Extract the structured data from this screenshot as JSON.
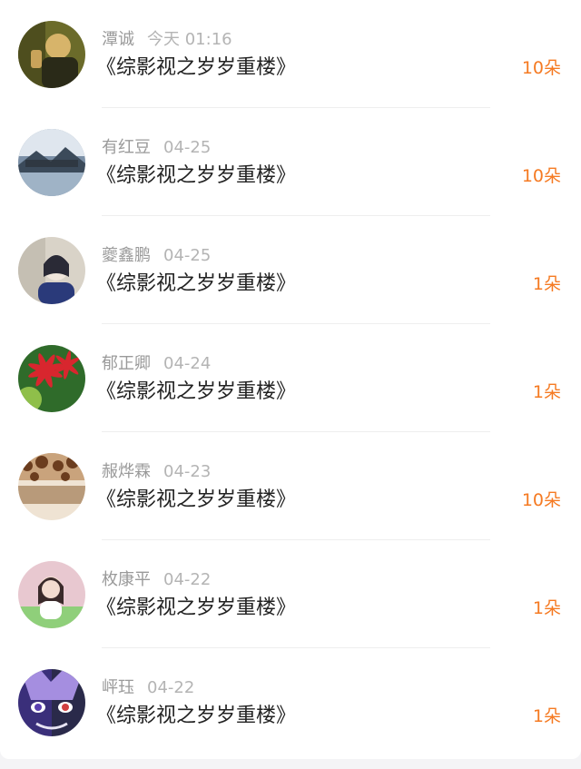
{
  "records": [
    {
      "name": "潭诚",
      "time": "今天 01:16",
      "title": "《综影视之岁岁重楼》",
      "amount": "10朵",
      "avatar_icon": "avatar-smoking-man-icon",
      "colors": [
        "#6b6b2a",
        "#d7b46a",
        "#2a2a18"
      ]
    },
    {
      "name": "有红豆",
      "time": "04-25",
      "title": "《综影视之岁岁重楼》",
      "amount": "10朵",
      "avatar_icon": "avatar-mountain-lake-icon",
      "colors": [
        "#7b8fa6",
        "#dfe6ee",
        "#3b4a5a"
      ]
    },
    {
      "name": "夔鑫鹏",
      "time": "04-25",
      "title": "《综影视之岁岁重楼》",
      "amount": "1朵",
      "avatar_icon": "avatar-girl-portrait-icon",
      "colors": [
        "#d9d3c8",
        "#2a2a36",
        "#f0e6dc"
      ]
    },
    {
      "name": "郁正卿",
      "time": "04-24",
      "title": "《综影视之岁岁重楼》",
      "amount": "1朵",
      "avatar_icon": "avatar-red-flower-icon",
      "colors": [
        "#2f6b2a",
        "#d8262e",
        "#8fbf4a"
      ]
    },
    {
      "name": "赧烨霖",
      "time": "04-23",
      "title": "《综影视之岁岁重楼》",
      "amount": "10朵",
      "avatar_icon": "avatar-dessert-icon",
      "colors": [
        "#c9a37c",
        "#6b3d1e",
        "#efe3d3"
      ]
    },
    {
      "name": "枚康平",
      "time": "04-22",
      "title": "《综影视之岁岁重楼》",
      "amount": "1朵",
      "avatar_icon": "avatar-girl-garden-icon",
      "colors": [
        "#e8c8d0",
        "#3a2a2a",
        "#8fcf7a"
      ]
    },
    {
      "name": "岼珏",
      "time": "04-22",
      "title": "《综影视之岁岁重楼》",
      "amount": "1朵",
      "avatar_icon": "avatar-anime-character-icon",
      "colors": [
        "#3a2f7a",
        "#a58ee0",
        "#e8e4f4"
      ]
    }
  ]
}
